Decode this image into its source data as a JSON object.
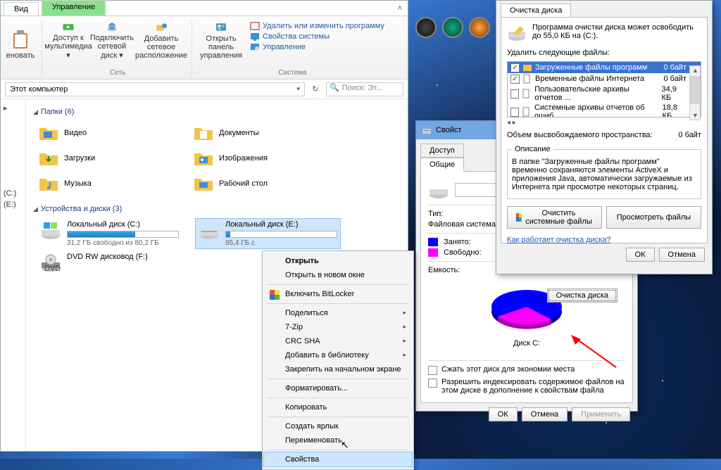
{
  "explorer": {
    "tabs": {
      "view": "Вид",
      "manage": "Управление"
    },
    "ribbon": {
      "rename": "еновать",
      "media_access": "Доступ к\nмультимедиа ▾",
      "connect_drive": "Подключить\nсетевой диск ▾",
      "add_net_loc": "Добавить сетевое\nрасположение",
      "open_ctrl": "Открыть панель\nуправления",
      "sys_delete": "Удалить или изменить программу",
      "sys_props": "Свойства системы",
      "sys_mgr": "Управление",
      "group_network": "Сеть",
      "group_system": "Система"
    },
    "breadcrumb": "Этот компьютер",
    "search_placeholder": "Поиск: Эт...",
    "sections": {
      "folders": "Папки (6)",
      "drives": "Устройства и диски (3)"
    },
    "side_tree": {
      "c": "(C:)",
      "e": "(E:)"
    },
    "folders": [
      {
        "name": "Видео"
      },
      {
        "name": "Документы"
      },
      {
        "name": "Загрузки"
      },
      {
        "name": "Изображения"
      },
      {
        "name": "Музыка"
      },
      {
        "name": "Рабочий стол"
      }
    ],
    "drives": {
      "c": {
        "name": "Локальный диск (C:)",
        "free": "31,2 ГБ свободно из 80,2 ГБ",
        "fill": 61
      },
      "e": {
        "name": "Локальный диск (E:)",
        "free": "95,4 ГБ с",
        "fill": 4
      },
      "dvd": {
        "name": "DVD RW дисковод (F:)"
      }
    }
  },
  "context_menu": {
    "open": "Открыть",
    "open_new": "Открыть в новом окне",
    "bitlocker": "Включить BitLocker",
    "share": "Поделиться",
    "zip": "7-Zip",
    "crc": "CRC SHA",
    "library": "Добавить в библиотеку",
    "pin": "Закрепить на начальном экране",
    "format": "Форматировать...",
    "copy": "Копировать",
    "shortcut": "Создать ярлык",
    "rename": "Переименовать",
    "properties": "Свойства"
  },
  "properties": {
    "title": "Свойст",
    "tabs": {
      "access": "Доступ",
      "general": "Общие"
    },
    "type_lbl": "Тип:",
    "fs_lbl": "Файловая система:",
    "used_lbl": "Занято:",
    "free_lbl": "Свободно:",
    "capacity_lbl": "Емкость:",
    "drive_caption": "Диск C:",
    "cleanup_btn": "Очистка диска",
    "compress": "Сжать этот диск для экономии места",
    "index": "Разрешить индексировать содержимое файлов на этом диске в дополнение к свойствам файла",
    "ok": "ОК",
    "cancel": "Отмена",
    "apply": "Применить"
  },
  "cleanup": {
    "tab": "Очистка диска",
    "intro": "Программа очистки диска может освободить до 55,0 КБ на  (C:).",
    "delete_label": "Удалить следующие файлы:",
    "rows": [
      {
        "chk": true,
        "label": "Загруженные файлы программ",
        "size": "0 байт",
        "sel": true
      },
      {
        "chk": true,
        "label": "Временные файлы Интернета",
        "size": "0 байт"
      },
      {
        "chk": false,
        "label": "Пользовательские архивы отчетов ...",
        "size": "34,9 КБ"
      },
      {
        "chk": false,
        "label": "Системные архивы отчетов об ошиб...",
        "size": "18,8 КБ"
      }
    ],
    "freed_label": "Объем высвобождаемого пространства:",
    "freed_value": "0 байт",
    "desc_title": "Описание",
    "desc_body": "В папке \"Загруженные файлы программ\" временно сохраняются элементы ActiveX и приложения Java, автоматически загружаемые из Интернета при просмотре некоторых страниц.",
    "sys_btn": "Очистить системные файлы",
    "view_btn": "Просмотреть файлы",
    "link": "Как работает очистка диска?",
    "ok": "ОК",
    "cancel": "Отмена"
  },
  "chart_data": {
    "type": "pie",
    "title": "Диск C:",
    "series": [
      {
        "name": "Занято",
        "value": 61,
        "color": "#0000ff"
      },
      {
        "name": "Свободно",
        "value": 39,
        "color": "#ff00ff"
      }
    ]
  }
}
